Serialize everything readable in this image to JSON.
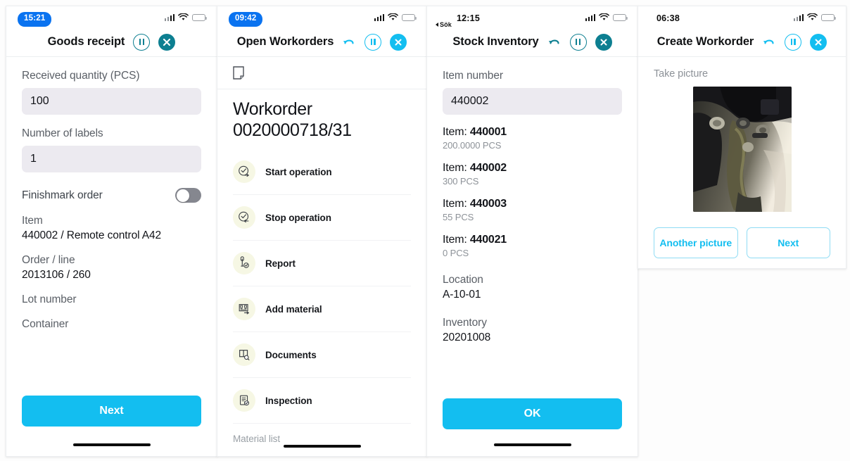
{
  "panels": [
    {
      "id": "goods-receipt",
      "status": {
        "time": "15:21",
        "time_style": "pill",
        "battery": "low"
      },
      "header": {
        "title": "Goods receipt",
        "accent": "#0d7f91",
        "has_undo": false,
        "pause_label": "pause",
        "close_label": "close"
      },
      "fields": [
        {
          "label": "Received quantity (PCS)",
          "value": "100"
        },
        {
          "label": "Number of labels",
          "value": "1"
        }
      ],
      "toggle": {
        "label": "Finishmark order",
        "on": false
      },
      "details": [
        {
          "key": "Item",
          "value": "440002 / Remote control A42"
        },
        {
          "key": "Order / line",
          "value": "2013106 / 260"
        },
        {
          "key": "Lot number",
          "value": ""
        },
        {
          "key": "Container",
          "value": ""
        }
      ],
      "primary_button": "Next"
    },
    {
      "id": "open-workorders",
      "status": {
        "time": "09:42",
        "time_style": "pill",
        "battery": "mid"
      },
      "header": {
        "title": "Open Workorders",
        "accent": "#13bef0",
        "has_undo": true,
        "undo_label": "undo",
        "pause_label": "pause",
        "close_label": "close"
      },
      "note_icon": "document-icon",
      "workorder_title": "Workorder 0020000718/31",
      "menu": [
        {
          "label": "Start operation",
          "icon": "clock-start-icon"
        },
        {
          "label": "Stop operation",
          "icon": "clock-stop-icon"
        },
        {
          "label": "Report",
          "icon": "report-icon"
        },
        {
          "label": "Add material",
          "icon": "add-material-icon"
        },
        {
          "label": "Documents",
          "icon": "documents-search-icon"
        },
        {
          "label": "Inspection",
          "icon": "inspection-icon"
        }
      ],
      "footer_text": "Material list"
    },
    {
      "id": "stock-inventory",
      "status": {
        "time": "12:15",
        "time_style": "plain",
        "battery": "mid",
        "back_hint": "Sök"
      },
      "header": {
        "title": "Stock Inventory",
        "accent": "#0d7f91",
        "has_undo": true,
        "undo_label": "undo",
        "pause_label": "pause",
        "close_label": "close"
      },
      "field": {
        "label": "Item number",
        "value": "440002"
      },
      "items": [
        {
          "prefix": "Item: ",
          "number": "440001",
          "qty": "200.0000 PCS"
        },
        {
          "prefix": "Item: ",
          "number": "440002",
          "qty": "300 PCS"
        },
        {
          "prefix": "Item: ",
          "number": "440003",
          "qty": "55 PCS"
        },
        {
          "prefix": "Item: ",
          "number": "440021",
          "qty": "0 PCS"
        }
      ],
      "details": [
        {
          "key": "Location",
          "value": "A-10-01"
        },
        {
          "key": "Inventory",
          "value": "20201008"
        }
      ],
      "primary_button": "OK"
    },
    {
      "id": "create-workorder",
      "status": {
        "time": "06:38",
        "time_style": "plain",
        "battery": "mid"
      },
      "header": {
        "title": "Create Workorder",
        "accent": "#13bef0",
        "has_undo": true,
        "undo_label": "undo",
        "pause_label": "pause",
        "close_label": "close"
      },
      "label": "Take picture",
      "photo_alt": "machine-part-photo",
      "buttons": [
        {
          "label": "Another picture"
        },
        {
          "label": "Next"
        }
      ]
    }
  ]
}
